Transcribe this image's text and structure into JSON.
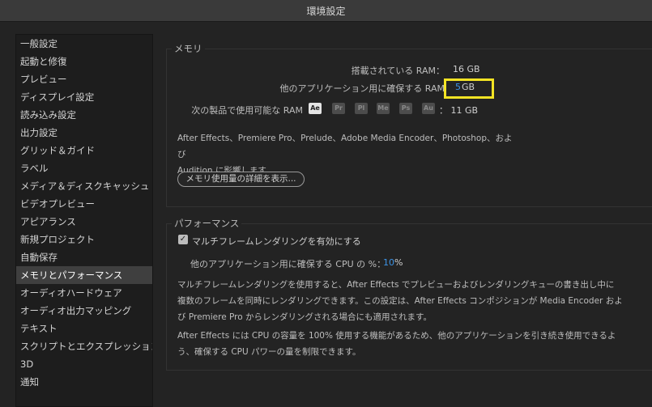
{
  "window": {
    "title": "環境設定"
  },
  "sidebar": {
    "items": [
      "一般設定",
      "起動と修復",
      "プレビュー",
      "ディスプレイ設定",
      "読み込み設定",
      "出力設定",
      "グリッド＆ガイド",
      "ラベル",
      "メディア＆ディスクキャッシュ",
      "ビデオプレビュー",
      "アピアランス",
      "新規プロジェクト",
      "自動保存",
      "メモリとパフォーマンス",
      "オーディオハードウェア",
      "オーディオ出力マッピング",
      "テキスト",
      "スクリプトとエクスプレッション",
      "3D",
      "通知"
    ],
    "selected_index": 13
  },
  "memory": {
    "section_title": "メモリ",
    "installed_label": "搭載されている RAM：",
    "installed_value": "16 GB",
    "reserved_label": "他のアプリケーション用に確保する RAM",
    "reserved_value": "5",
    "reserved_unit": "GB",
    "available_label": "次の製品で使用可能な RAM",
    "apps": [
      "Ae",
      "Pr",
      "Pl",
      "Me",
      "Ps",
      "Au"
    ],
    "available_value": "：  11 GB",
    "shared_note_line1": "After Effects、Premiere Pro、Prelude、Adobe Media Encoder、Photoshop、および",
    "shared_note_line2": "Audition に影響します。",
    "details_button": "メモリ使用量の詳細を表示..."
  },
  "performance": {
    "section_title": "パフォーマンス",
    "mfr_checkbox_label": "マルチフレームレンダリングを有効にする",
    "mfr_checked": true,
    "cpu_label": "他のアプリケーション用に確保する CPU の %：",
    "cpu_value": "10",
    "cpu_unit": "%",
    "para1_line1": "マルチフレームレンダリングを使用すると、After Effects でプレビューおよびレンダリングキューの書き出し中に",
    "para1_line2": "複数のフレームを同時にレンダリングできます。この設定は、After Effects コンポジションが Media Encoder およ",
    "para1_line3": "び Premiere Pro からレンダリングされる場合にも適用されます。",
    "para2_line1": "After Effects には CPU の容量を 100% 使用する機能があるため、他のアプリケーションを引き続き使用できるよ",
    "para2_line2": "う、確保する CPU パワーの量を制限できます。"
  },
  "colors": {
    "accent_blue": "#3d95e8",
    "highlight_yellow": "#f2e324"
  }
}
